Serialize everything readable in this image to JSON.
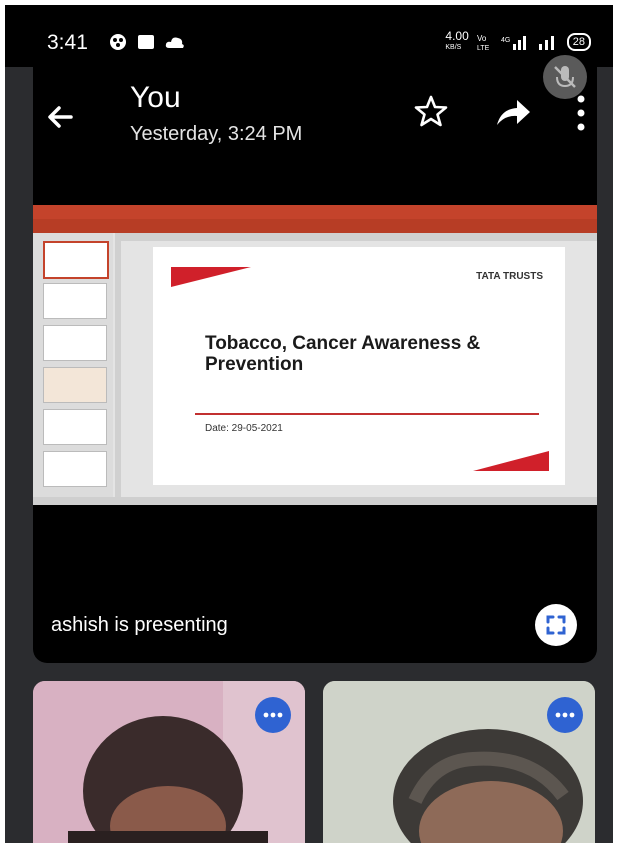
{
  "status_bar": {
    "time": "3:41",
    "data_speed": "4.00",
    "data_unit": "KB/S",
    "battery": "28"
  },
  "header": {
    "title": "You",
    "subtitle": "Yesterday, 3:24 PM"
  },
  "slide": {
    "brand": "TATA TRUSTS",
    "heading": "Tobacco, Cancer Awareness & Prevention",
    "date": "Date: 29-05-2021"
  },
  "presenter": {
    "label": "ashish is presenting"
  },
  "colors": {
    "accent_red": "#d0202a",
    "ppt_ribbon": "#c4432b",
    "mic_badge": "#2f63d2"
  },
  "icons": [
    "back-arrow-icon",
    "star-icon",
    "share-icon",
    "more-vert-icon",
    "mic-off-icon",
    "fullscreen-icon",
    "audio-level-icon"
  ]
}
